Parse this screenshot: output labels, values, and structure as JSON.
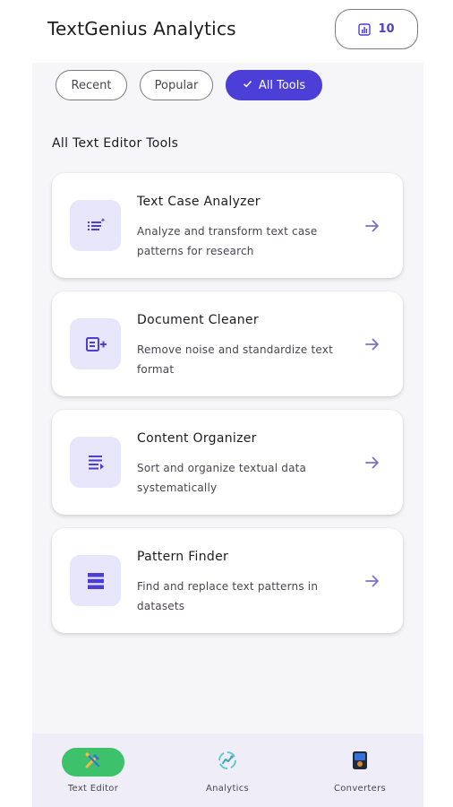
{
  "header": {
    "title": "TextGenius Analytics",
    "count_badge": "10",
    "count_icon": "bar-chart-icon"
  },
  "filters": {
    "chips": [
      {
        "label": "Recent",
        "selected": false
      },
      {
        "label": "Popular",
        "selected": false
      },
      {
        "label": "All Tools",
        "selected": true
      }
    ]
  },
  "section": {
    "title": "All Text Editor Tools"
  },
  "tools": [
    {
      "title": "Text Case Analyzer",
      "description": "Analyze and transform text case patterns for research",
      "icon": "list-sparkle-icon"
    },
    {
      "title": "Document Cleaner",
      "description": "Remove noise and standardize text format",
      "icon": "document-plus-icon"
    },
    {
      "title": "Content Organizer",
      "description": "Sort and organize textual data systematically",
      "icon": "align-list-icon"
    },
    {
      "title": "Pattern Finder",
      "description": "Find and replace text patterns in datasets",
      "icon": "stack-icon"
    }
  ],
  "bottom_nav": {
    "items": [
      {
        "label": "Text Editor",
        "icon": "tools-icon",
        "selected": true
      },
      {
        "label": "Analytics",
        "icon": "analytics-icon",
        "selected": false
      },
      {
        "label": "Converters",
        "icon": "converters-icon",
        "selected": false
      }
    ]
  },
  "colors": {
    "accent": "#4b3fd8",
    "icon_bg": "#e8e6fb",
    "nav_active": "#3ec16b",
    "arrow": "#7a70cf"
  }
}
